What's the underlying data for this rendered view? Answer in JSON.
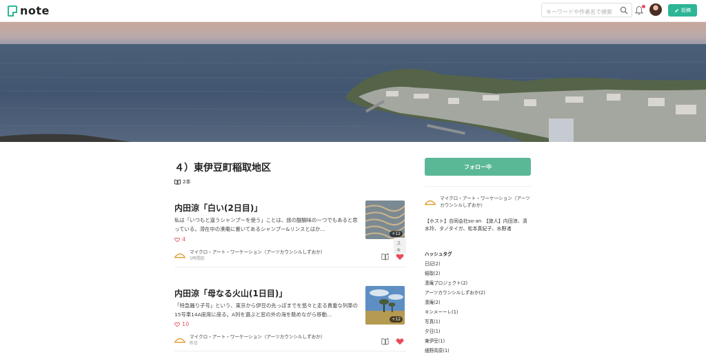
{
  "header": {
    "logo_text": "note",
    "search_placeholder": "キーワードや作者名で検索",
    "post_label": "投稿",
    "accent_color": "#2cb696",
    "notification_dot_color": "#e94b5a"
  },
  "magazine": {
    "title": "４）東伊豆町稲取地区",
    "count": "2本"
  },
  "articles": [
    {
      "title": "内田涼「白い(2日目)」",
      "excerpt": "私は「いつもと違うシャンプーを使う」ことは、旅の醍醐味の一つでもあると思っている。滞在中の湊庵に置いてあるシャンプー&リンスとはか…",
      "likes": "4",
      "thumb_badge": "+12",
      "creator": "マイクロ・アート・ワーケーション（アーツカウンシルしずおか）",
      "time": "5時間前",
      "liked": true
    },
    {
      "title": "内田涼「母なる火山(1日目)」",
      "excerpt": "「特急踊り子号」という、東京から伊豆の先っぽまでを悠々と走る貴重な列車の15号車14A座席に座る。A列を選ぶと窓の外の海を眺めながら移動…",
      "likes": "10",
      "thumb_badge": "+12",
      "creator": "マイクロ・アート・ワーケーション（アーツカウンシルしずおか）",
      "time": "昨日",
      "liked": true
    }
  ],
  "tooltip": "スキ",
  "sidebar": {
    "follow_label": "フォロー中",
    "creator": "マイクロ・アート・ワーケーション（アーツカウンシルしずおか）",
    "description": "【ホスト】合同会社so-an　【旅人】内田涼、清水玲、タノタイガ、松本真紀子、水野渚",
    "hashtag_heading": "ハッシュタグ",
    "tags": [
      "日記(2)",
      "稲取(2)",
      "湊庵プロジェクト(2)",
      "アーツカウンシルしずおか(2)",
      "湊庵(2)",
      "キンメーーレ(1)",
      "写真(1)",
      "夕日(1)",
      "東伊豆(1)",
      "細野高原(1)"
    ]
  }
}
